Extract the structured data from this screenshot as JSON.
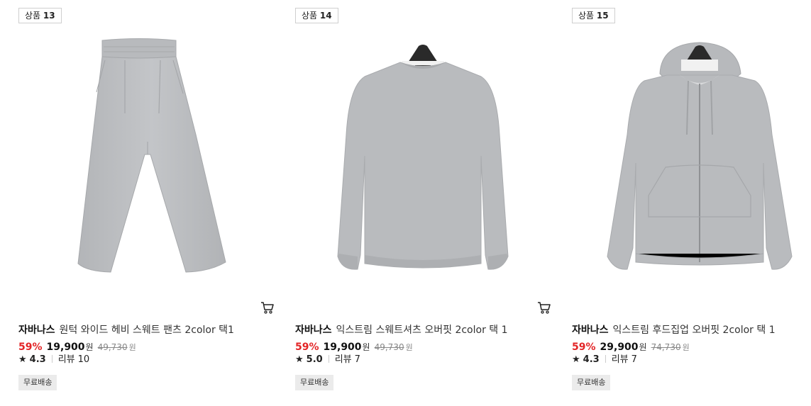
{
  "products": [
    {
      "badge_prefix": "상품",
      "badge_number": "13",
      "brand": "자바나스",
      "name": "원턱 와이드 헤비 스웨트 팬츠 2color 택1",
      "discount": "59%",
      "price": "19,900",
      "currency": "원",
      "original_price": "49,730",
      "rating": "4.3",
      "reviews_label": "리뷰",
      "reviews_count": "10",
      "shipping": "무료배송",
      "image_icon": "sweatpants-image",
      "cart_icon": "cart-icon"
    },
    {
      "badge_prefix": "상품",
      "badge_number": "14",
      "brand": "자바나스",
      "name": "익스트림 스웨트셔츠 오버핏 2color 택 1",
      "discount": "59%",
      "price": "19,900",
      "currency": "원",
      "original_price": "49,730",
      "rating": "5.0",
      "reviews_label": "리뷰",
      "reviews_count": "7",
      "shipping": "무료배송",
      "image_icon": "sweatshirt-image",
      "cart_icon": "cart-icon"
    },
    {
      "badge_prefix": "상품",
      "badge_number": "15",
      "brand": "자바나스",
      "name": "익스트림 후드집업 오버핏 2color 택 1",
      "discount": "59%",
      "price": "29,900",
      "currency": "원",
      "original_price": "74,730",
      "rating": "4.3",
      "reviews_label": "리뷰",
      "reviews_count": "7",
      "shipping": "무료배송",
      "image_icon": "hoodie-zipup-image",
      "cart_icon": "cart-icon"
    }
  ],
  "colors": {
    "discount": "#e32527",
    "garment": "#b9bbbe",
    "hanger": "#2a2a2a",
    "shipping_bg": "#ebebeb"
  }
}
